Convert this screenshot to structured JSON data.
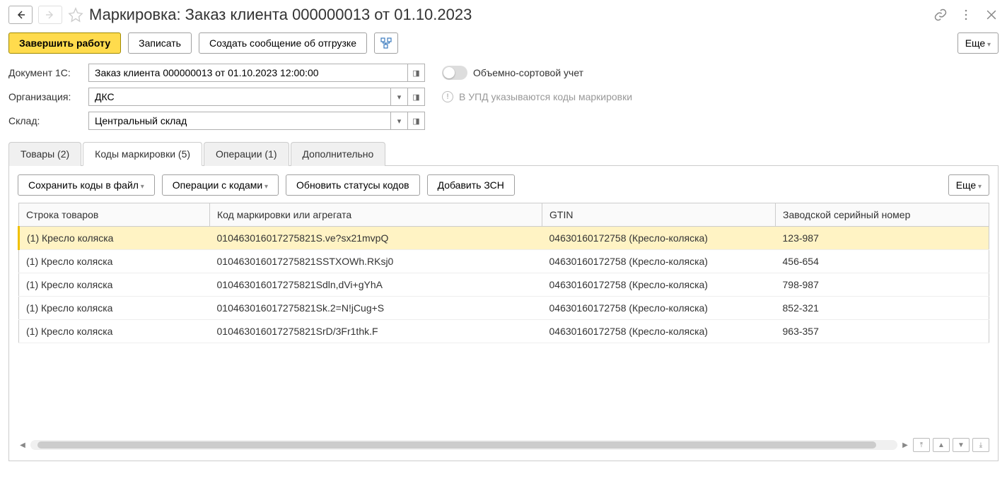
{
  "header": {
    "title": "Маркировка: Заказ клиента 000000013 от 01.10.2023"
  },
  "toolbar": {
    "finish": "Завершить работу",
    "save": "Записать",
    "create_ship": "Создать сообщение об отгрузке",
    "more": "Еще"
  },
  "form": {
    "doc_label": "Документ 1С:",
    "doc_value": "Заказ клиента 000000013 от 01.10.2023 12:00:00",
    "org_label": "Организация:",
    "org_value": "ДКС",
    "warehouse_label": "Склад:",
    "warehouse_value": "Центральный склад",
    "osu_label": "Объемно-сортовой учет",
    "info_text": "В УПД указываются коды маркировки"
  },
  "tabs": {
    "goods": "Товары (2)",
    "codes": "Коды маркировки (5)",
    "ops": "Операции (1)",
    "extra": "Дополнительно"
  },
  "tab_toolbar": {
    "save_codes": "Сохранить коды в файл",
    "code_ops": "Операции с кодами",
    "update_status": "Обновить статусы кодов",
    "add_zsn": "Добавить ЗСН",
    "more": "Еще"
  },
  "table": {
    "headers": {
      "row": "Строка товаров",
      "code": "Код маркировки или агрегата",
      "gtin": "GTIN",
      "serial": "Заводской серийный номер"
    },
    "rows": [
      {
        "row": "(1) Кресло коляска",
        "code": "010463016017275821S.ve?sx21mvpQ",
        "gtin": "04630160172758 (Кресло-коляска)",
        "serial": "123-987"
      },
      {
        "row": "(1) Кресло коляска",
        "code": "010463016017275821SSTXOWh.RKsj0",
        "gtin": "04630160172758 (Кресло-коляска)",
        "serial": "456-654"
      },
      {
        "row": "(1) Кресло коляска",
        "code": "010463016017275821Sdln,dVi+gYhA",
        "gtin": "04630160172758 (Кресло-коляска)",
        "serial": "798-987"
      },
      {
        "row": "(1) Кресло коляска",
        "code": "010463016017275821Sk.2=N!jCug+S",
        "gtin": "04630160172758 (Кресло-коляска)",
        "serial": "852-321"
      },
      {
        "row": "(1) Кресло коляска",
        "code": "010463016017275821SrD/3Fr1thk.F",
        "gtin": "04630160172758 (Кресло-коляска)",
        "serial": "963-357"
      }
    ]
  }
}
